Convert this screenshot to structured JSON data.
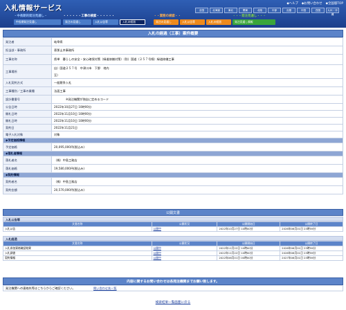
{
  "header": {
    "app_title": "入札情報サービス",
    "links": [
      "◆ヘルプ",
      "◆お問い合わせ",
      "◆全国版TOP"
    ],
    "regions": [
      "全国",
      "北海道",
      "東北",
      "関東",
      "北陸",
      "中部",
      "近畿",
      "中国",
      "四国",
      "九州・沖縄"
    ],
    "groups": [
      {
        "label": "・中長期的発注見通し・",
        "color": "#9ec8ff"
      },
      {
        "label": "・・・・・・工事の検索・・・・・・",
        "color": "#ffffff"
      },
      {
        "label": "・・業務の検索・・",
        "color": "#ffb050"
      },
      {
        "label": "・・・発注見通し・・・",
        "color": "#7fd24a"
      }
    ],
    "tabs": [
      {
        "label": "中長期発注見通し",
        "color": "#4a7cc9",
        "active": false
      },
      {
        "label": "発注の見通し",
        "color": "#4a7cc9",
        "active": false
      },
      {
        "label": "入札公告等",
        "color": "#4a7cc9",
        "active": false
      },
      {
        "label": "入札の経過",
        "color": "#0c2460",
        "active": true
      },
      {
        "label": "発注の見通し",
        "color": "#ee8a1c",
        "active": false
      },
      {
        "label": "入札公告等",
        "color": "#ee8a1c",
        "active": false
      },
      {
        "label": "入札の経過",
        "color": "#ee8a1c",
        "active": false
      },
      {
        "label": "発注見通し情報",
        "color": "#3aa53a",
        "active": false
      }
    ]
  },
  "detail": {
    "title": "入札の経過（工事）案件概要",
    "rows": {
      "issuer_label": "発注者",
      "issuer": "岐阜県",
      "office_label": "担当部・事務所",
      "office": "恵那土木事務所",
      "work_name_label": "工事名称",
      "work_name": "県単　暮らしの安全・安心確保対策（緑道修繕対策）（防）国道（２５７号線）緑道修繕工事",
      "location_label": "工事場所",
      "location": "自）国道２５７号　中津川市　下野　地内",
      "location_to": "至）",
      "method_label": "入札契約方式",
      "method": "一般競争入札",
      "category_label": "工事種別／工事の業種",
      "category": "法面工事",
      "design_label": "設計書番号",
      "design": "※発注機関が独自に定めるコード",
      "notice_date_label": "公告日時",
      "notice_date": "2022年10月27日 10時00分",
      "open_date_label": "開札日時",
      "open_date": "2022年11月10日 10時00分",
      "bid_date_label": "開札日時",
      "bid_date": "2022年11月10日 10時00分",
      "contract_date_label": "契約日",
      "contract_date": "2022年11月21日",
      "ebid_label": "電子入札対象",
      "ebid": "対象"
    },
    "sections": {
      "planned_price": "◆予定価格情報",
      "winner": "◆落札者情報",
      "contractor": "◆契約情報"
    },
    "planned_price_label": "予定価格",
    "planned_price": "20,095,000円(税込み)",
    "winner_name_label": "落札者名",
    "winner_name": "（株）中島工務店",
    "winner_price_label": "落札価格",
    "winner_price": "19,580,000円(税込み)",
    "contractor_name_label": "契約者名",
    "contractor_name": "（株）中島工務店",
    "contract_amount_label": "契約金額",
    "contract_amount": "20,570,000円(税込み)"
  },
  "public_docs": {
    "title": "公開文書",
    "group1_title": "入札公告等",
    "group2_title": "入札経過",
    "columns": [
      "文書名称",
      "公開状況",
      "公開開始日",
      "公開終了日"
    ],
    "group1_rows": [
      [
        "入札公告",
        "公開中",
        "2022年10月27日 10時00分",
        "2026年06月01日 23時59分"
      ]
    ],
    "group2_rows": [
      [
        "入札参加資格確認結果",
        "公開中",
        "2022年11月22日 10時00分",
        "2026年06月01日 23時59分"
      ],
      [
        "入札調書",
        "公開中",
        "2022年11月22日 10時00分",
        "2026年06月01日 23時59分"
      ],
      [
        "契約情報",
        "公開中",
        "2022年06月01日 00時00分",
        "2027年06月01日 23時59分"
      ]
    ]
  },
  "contact": {
    "title": "内容に関するお問い合わせは各発注機関までお願い致します。",
    "text": "発注機関への連絡先等はこちらからご確認ください。",
    "link": "問い合わせ先一覧"
  },
  "back_link": "検索結果一覧画面に戻る"
}
